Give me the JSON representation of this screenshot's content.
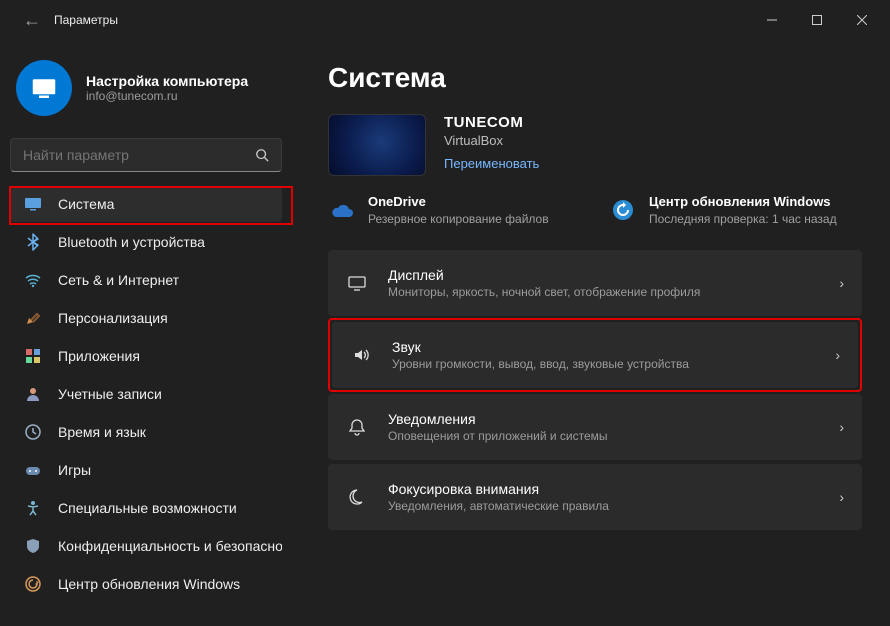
{
  "titlebar": {
    "title": "Параметры"
  },
  "user": {
    "name": "Настройка компьютера",
    "email": "info@tunecom.ru"
  },
  "search": {
    "placeholder": "Найти параметр"
  },
  "nav": [
    {
      "id": "system",
      "label": "Система",
      "active": true
    },
    {
      "id": "bluetooth",
      "label": "Bluetooth и устройства"
    },
    {
      "id": "network",
      "label": "Сеть & и Интернет"
    },
    {
      "id": "personalization",
      "label": "Персонализация"
    },
    {
      "id": "apps",
      "label": "Приложения"
    },
    {
      "id": "accounts",
      "label": "Учетные записи"
    },
    {
      "id": "time",
      "label": "Время и язык"
    },
    {
      "id": "gaming",
      "label": "Игры"
    },
    {
      "id": "accessibility",
      "label": "Специальные возможности"
    },
    {
      "id": "privacy",
      "label": "Конфиденциальность и безопасность"
    },
    {
      "id": "update",
      "label": "Центр обновления Windows"
    }
  ],
  "main": {
    "heading": "Система",
    "device": {
      "name": "TUNECOM",
      "sub": "VirtualBox",
      "rename": "Переименовать"
    },
    "status": {
      "onedrive": {
        "title": "OneDrive",
        "desc": "Резервное копирование файлов"
      },
      "update": {
        "title": "Центр обновления Windows",
        "desc": "Последняя проверка: 1 час назад"
      }
    },
    "cards": [
      {
        "id": "display",
        "title": "Дисплей",
        "desc": "Мониторы, яркость, ночной свет, отображение профиля"
      },
      {
        "id": "sound",
        "title": "Звук",
        "desc": "Уровни громкости, вывод, ввод, звуковые устройства",
        "highlighted": true
      },
      {
        "id": "notifications",
        "title": "Уведомления",
        "desc": "Оповещения от приложений и системы"
      },
      {
        "id": "focus",
        "title": "Фокусировка внимания",
        "desc": "Уведомления, автоматические правила"
      }
    ]
  }
}
